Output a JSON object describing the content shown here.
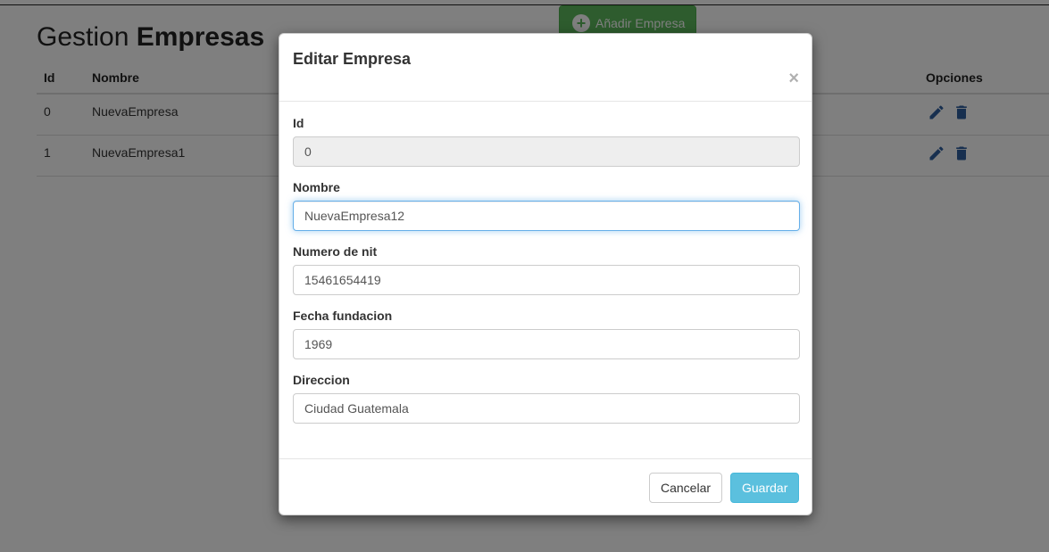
{
  "page": {
    "title_prefix": "Gestion",
    "title_bold": "Empresas",
    "add_button_label": "Añadir Empresa"
  },
  "table": {
    "headers": {
      "id": "Id",
      "name": "Nombre",
      "options": "Opciones"
    },
    "rows": [
      {
        "id": "0",
        "name": "NuevaEmpresa"
      },
      {
        "id": "1",
        "name": "NuevaEmpresa1"
      }
    ],
    "icon_color": "#2e5f9e"
  },
  "modal": {
    "title": "Editar Empresa",
    "close": "×",
    "fields": {
      "id": {
        "label": "Id",
        "value": "0"
      },
      "nombre": {
        "label": "Nombre",
        "value": "NuevaEmpresa12"
      },
      "nit": {
        "label": "Numero de nit",
        "value": "15461654419"
      },
      "fecha": {
        "label": "Fecha fundacion",
        "value": "1969"
      },
      "direccion": {
        "label": "Direccion",
        "value": "Ciudad Guatemala"
      }
    },
    "cancel_label": "Cancelar",
    "save_label": "Guardar"
  },
  "colors": {
    "add_button": "#5cb85c",
    "save_button": "#5bc0de",
    "focus_border": "#66afe9"
  },
  "icons": [
    "plus-circle-icon",
    "pencil-icon",
    "trash-icon"
  ]
}
